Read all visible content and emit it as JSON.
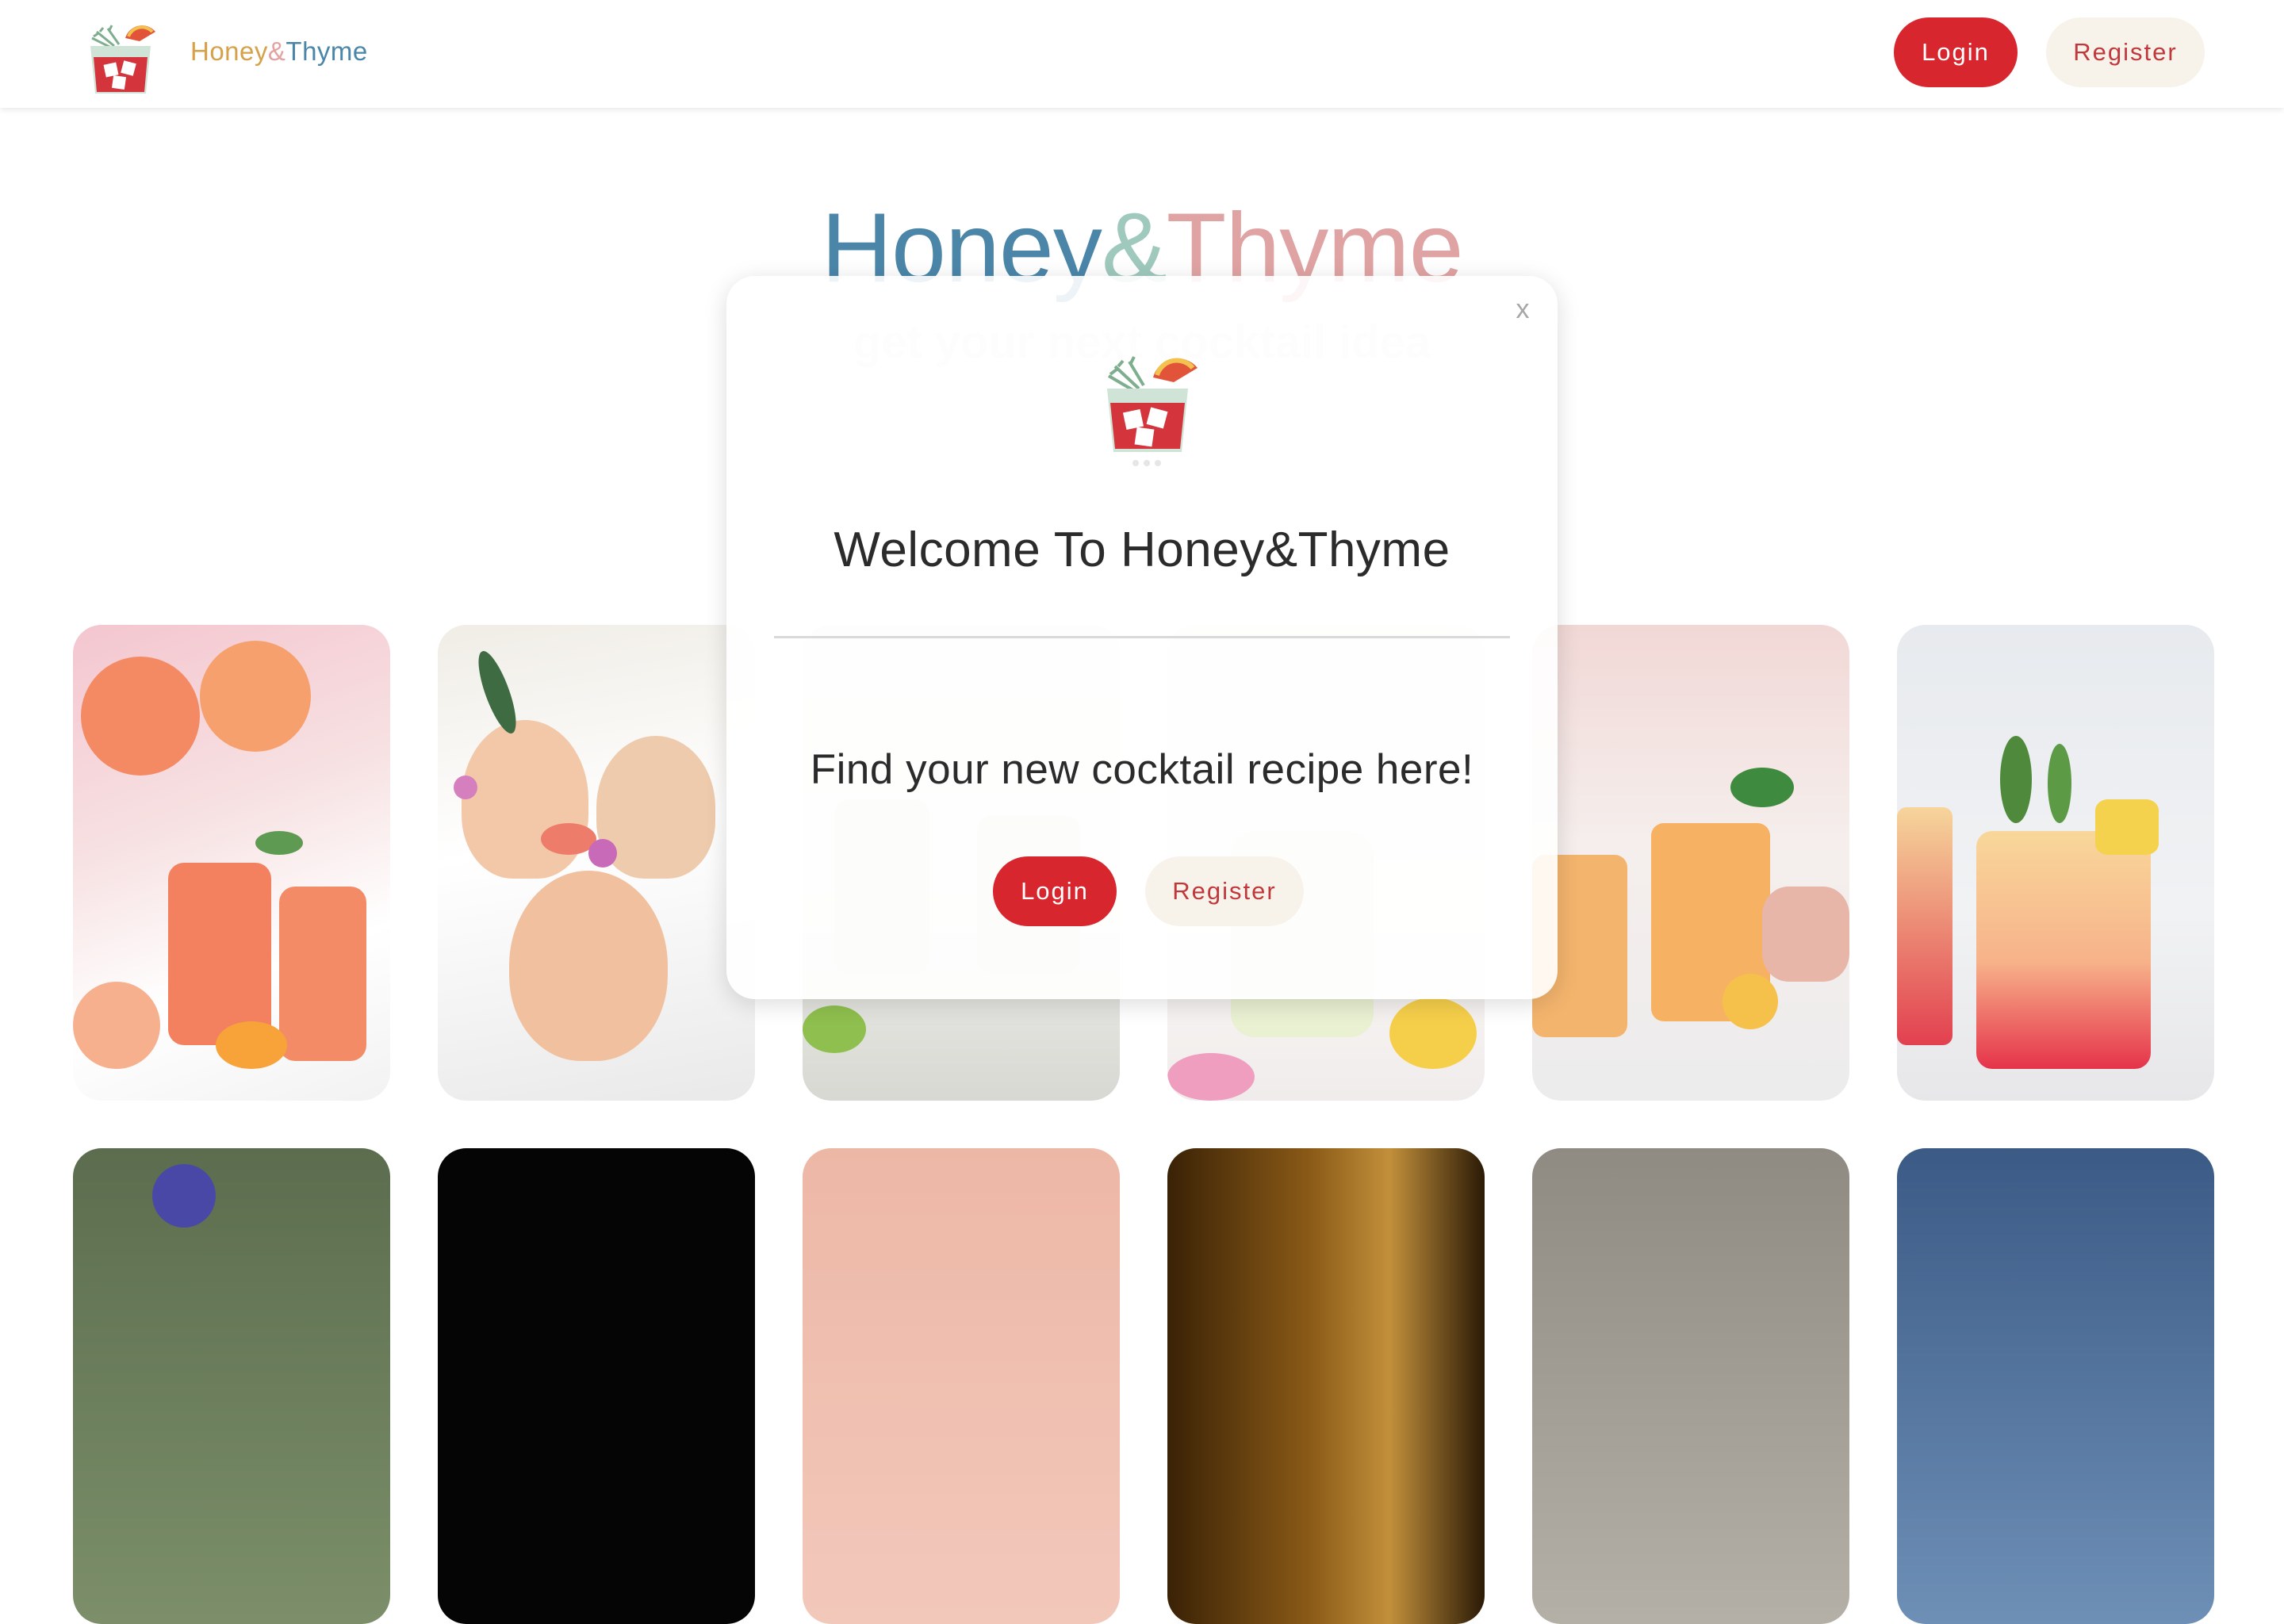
{
  "nav": {
    "brand_word1": "Honey",
    "brand_amp": "&",
    "brand_word2": "Thyme",
    "logo_icon": "cocktail-glass-icon",
    "login_label": "Login",
    "register_label": "Register"
  },
  "hero": {
    "title_word1": "Honey",
    "title_amp": "&",
    "title_word2": "Thyme",
    "subtitle": "get your next cocktail idea"
  },
  "modal": {
    "close_label": "x",
    "logo_icon": "cocktail-glass-icon",
    "title": "Welcome To Honey&Thyme",
    "message": "Find your new cocktail recipe here!",
    "login_label": "Login",
    "register_label": "Register"
  },
  "gallery": {
    "rows": [
      [
        {
          "image": "grapefruit-spritz-cocktails-photo"
        },
        {
          "image": "grapefruit-flower-garnish-cocktails-photo"
        },
        {
          "image": "lime-margarita-glasses-photo"
        },
        {
          "image": "lemonade-pitcher-with-petals-photo"
        },
        {
          "image": "passion-fruit-cocktails-photo"
        },
        {
          "image": "pineapple-sunrise-cocktail-photo"
        }
      ],
      [
        {
          "image": "blue-flower-cocktail-photo"
        },
        {
          "image": "dark-cocktail-photo"
        },
        {
          "image": "pink-cocktail-photo"
        },
        {
          "image": "amber-cocktail-photo"
        },
        {
          "image": "wooden-table-cocktail-photo"
        },
        {
          "image": "blue-background-cocktail-photo"
        }
      ]
    ]
  },
  "colors": {
    "accent_red": "#d7262e",
    "register_bg": "#f7f3eb",
    "brand_gold": "#d5a24a",
    "brand_blue": "#4a86a8",
    "brand_pink": "#e0a3a3",
    "brand_teal": "#9fc9bd"
  }
}
